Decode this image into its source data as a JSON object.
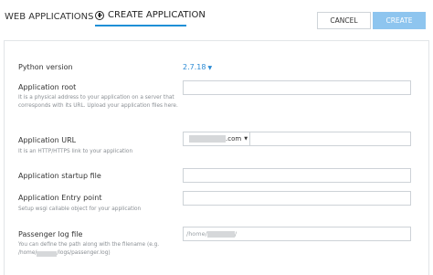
{
  "header": {
    "tab_web_label": "WEB APPLICATIONS",
    "tab_create_label": "CREATE APPLICATION",
    "cancel_label": "CANCEL",
    "create_label": "CREATE"
  },
  "form": {
    "python_version": {
      "label": "Python version",
      "value": "2.7.18"
    },
    "app_root": {
      "label": "Application root",
      "help": "It is a physical address to your application on a server that corresponds with its URL. Upload your application files here.",
      "value": ""
    },
    "app_url": {
      "label": "Application URL",
      "help": "It is an HTTP/HTTPS link to your application",
      "domain_suffix": ".com",
      "path_value": ""
    },
    "startup_file": {
      "label": "Application startup file",
      "value": ""
    },
    "entry_point": {
      "label": "Application Entry point",
      "help": "Setup wsgi callable object for your application",
      "value": ""
    },
    "log_file": {
      "label": "Passenger log file",
      "help_line1": "You can define the path along with the filename (e.g.",
      "help_line2_prefix": "/home/",
      "help_line2_suffix": "/logs/passenger.log)",
      "placeholder_prefix": "/home/",
      "placeholder_suffix": "/"
    }
  },
  "colors": {
    "accent": "#1f8fd6",
    "create_button": "#8ec5ef",
    "link": "#2a8ad4"
  }
}
